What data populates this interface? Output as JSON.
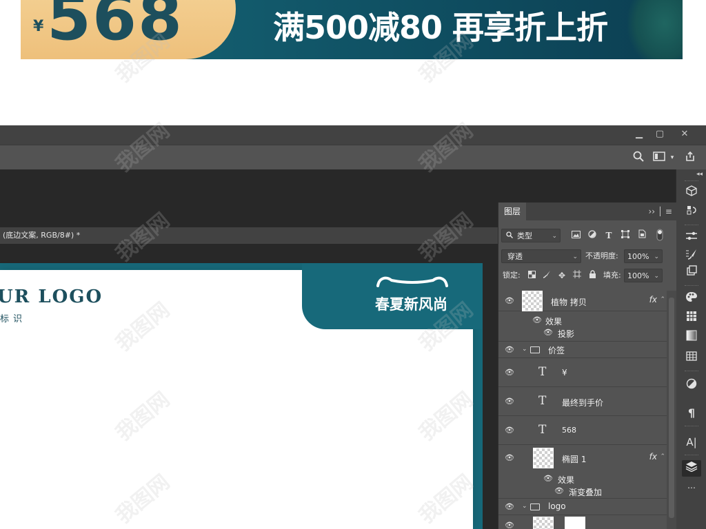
{
  "banner": {
    "currency": "¥",
    "price": "568",
    "promo": "满500减80 再享折上折"
  },
  "window": {
    "minimize": "▁",
    "maximize": "▢",
    "close": "✕"
  },
  "document": {
    "tab_label": "(底边文案, RGB/8#) *"
  },
  "artboard": {
    "logo": "UR LOGO",
    "logo_sub": "标识",
    "slogan": "春夏新风尚"
  },
  "layers_panel": {
    "tab": "图层",
    "filter_kind": "类型",
    "blend_mode": "穿透",
    "opacity_label": "不透明度:",
    "opacity_value": "100%",
    "lock_label": "锁定:",
    "fill_label": "填充:",
    "fill_value": "100%",
    "layers": [
      {
        "name": "植物 拷贝",
        "type": "image",
        "fx": "fx"
      },
      {
        "name": "效果",
        "type": "effects"
      },
      {
        "name": "投影",
        "type": "effect"
      },
      {
        "name": "价签",
        "type": "group"
      },
      {
        "name": "¥",
        "type": "text"
      },
      {
        "name": "最终到手价",
        "type": "text"
      },
      {
        "name": "568",
        "type": "text"
      },
      {
        "name": "椭圆 1",
        "type": "shape",
        "fx": "fx"
      },
      {
        "name": "效果",
        "type": "effects"
      },
      {
        "name": "渐变叠加",
        "type": "effect"
      },
      {
        "name": "logo",
        "type": "group"
      }
    ]
  },
  "icons": {
    "search": "search-icon",
    "workspace": "workspace-icon",
    "share": "share-icon",
    "eye": "eye-icon",
    "text_layer": "T"
  },
  "colors": {
    "teal": "#17697a",
    "gold": "#f2cb8b",
    "ps_bg": "#535353"
  },
  "watermark": "我图网"
}
